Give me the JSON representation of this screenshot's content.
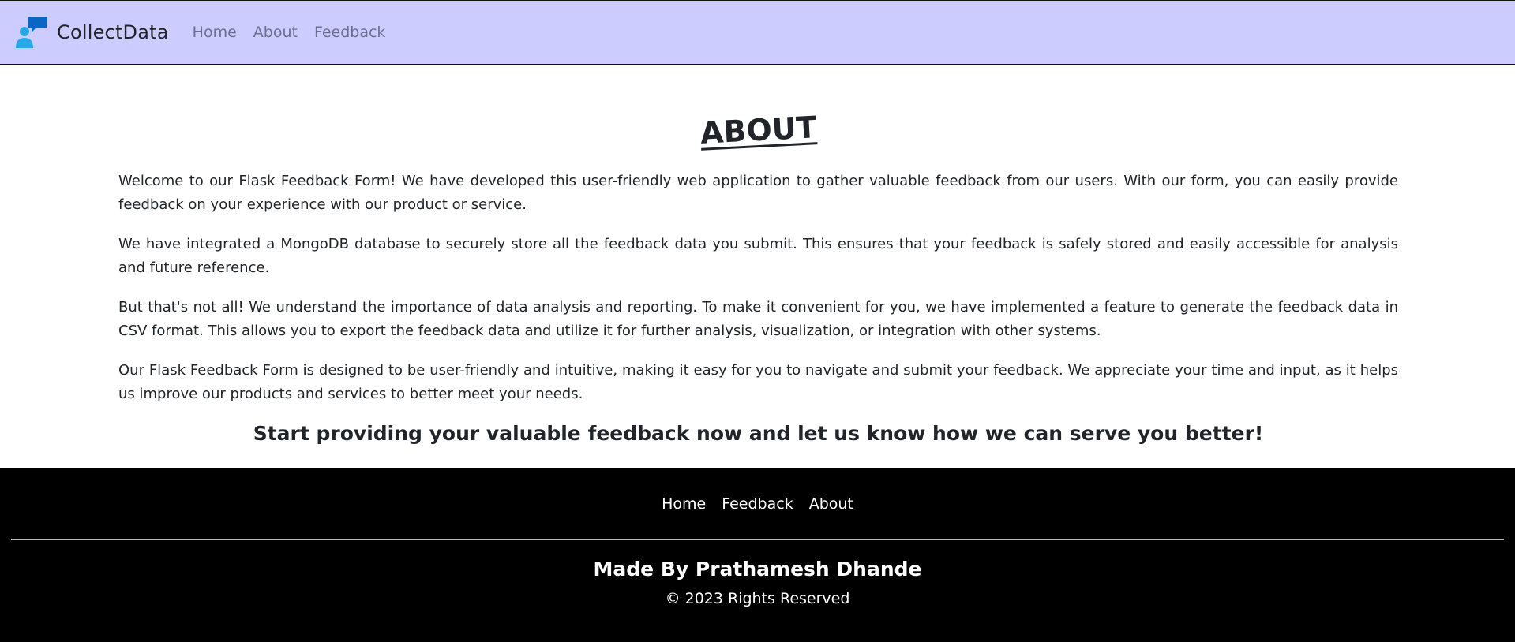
{
  "navbar": {
    "brand": "CollectData",
    "links": [
      "Home",
      "About",
      "Feedback"
    ],
    "background": "#ccccfe",
    "logo_icon": "chat-user-icon"
  },
  "main": {
    "title": "ABOUT",
    "paragraphs": [
      "Welcome to our Flask Feedback Form! We have developed this user-friendly web application to gather valuable feedback from our users. With our form, you can easily provide feedback on your experience with our product or service.",
      "We have integrated a MongoDB database to securely store all the feedback data you submit. This ensures that your feedback is safely stored and easily accessible for analysis and future reference.",
      "But that's not all! We understand the importance of data analysis and reporting. To make it convenient for you, we have implemented a feature to generate the feedback data in CSV format. This allows you to export the feedback data and utilize it for further analysis, visualization, or integration with other systems.",
      "Our Flask Feedback Form is designed to be user-friendly and intuitive, making it easy for you to navigate and submit your feedback. We appreciate your time and input, as it helps us improve our products and services to better meet your needs."
    ],
    "cta": "Start providing your valuable feedback now and let us know how we can serve you better!"
  },
  "footer": {
    "links": [
      "Home",
      "Feedback",
      "About"
    ],
    "made_by": "Made By Prathamesh Dhande",
    "copyright": "© 2023 Rights Reserved",
    "background": "#000000"
  }
}
